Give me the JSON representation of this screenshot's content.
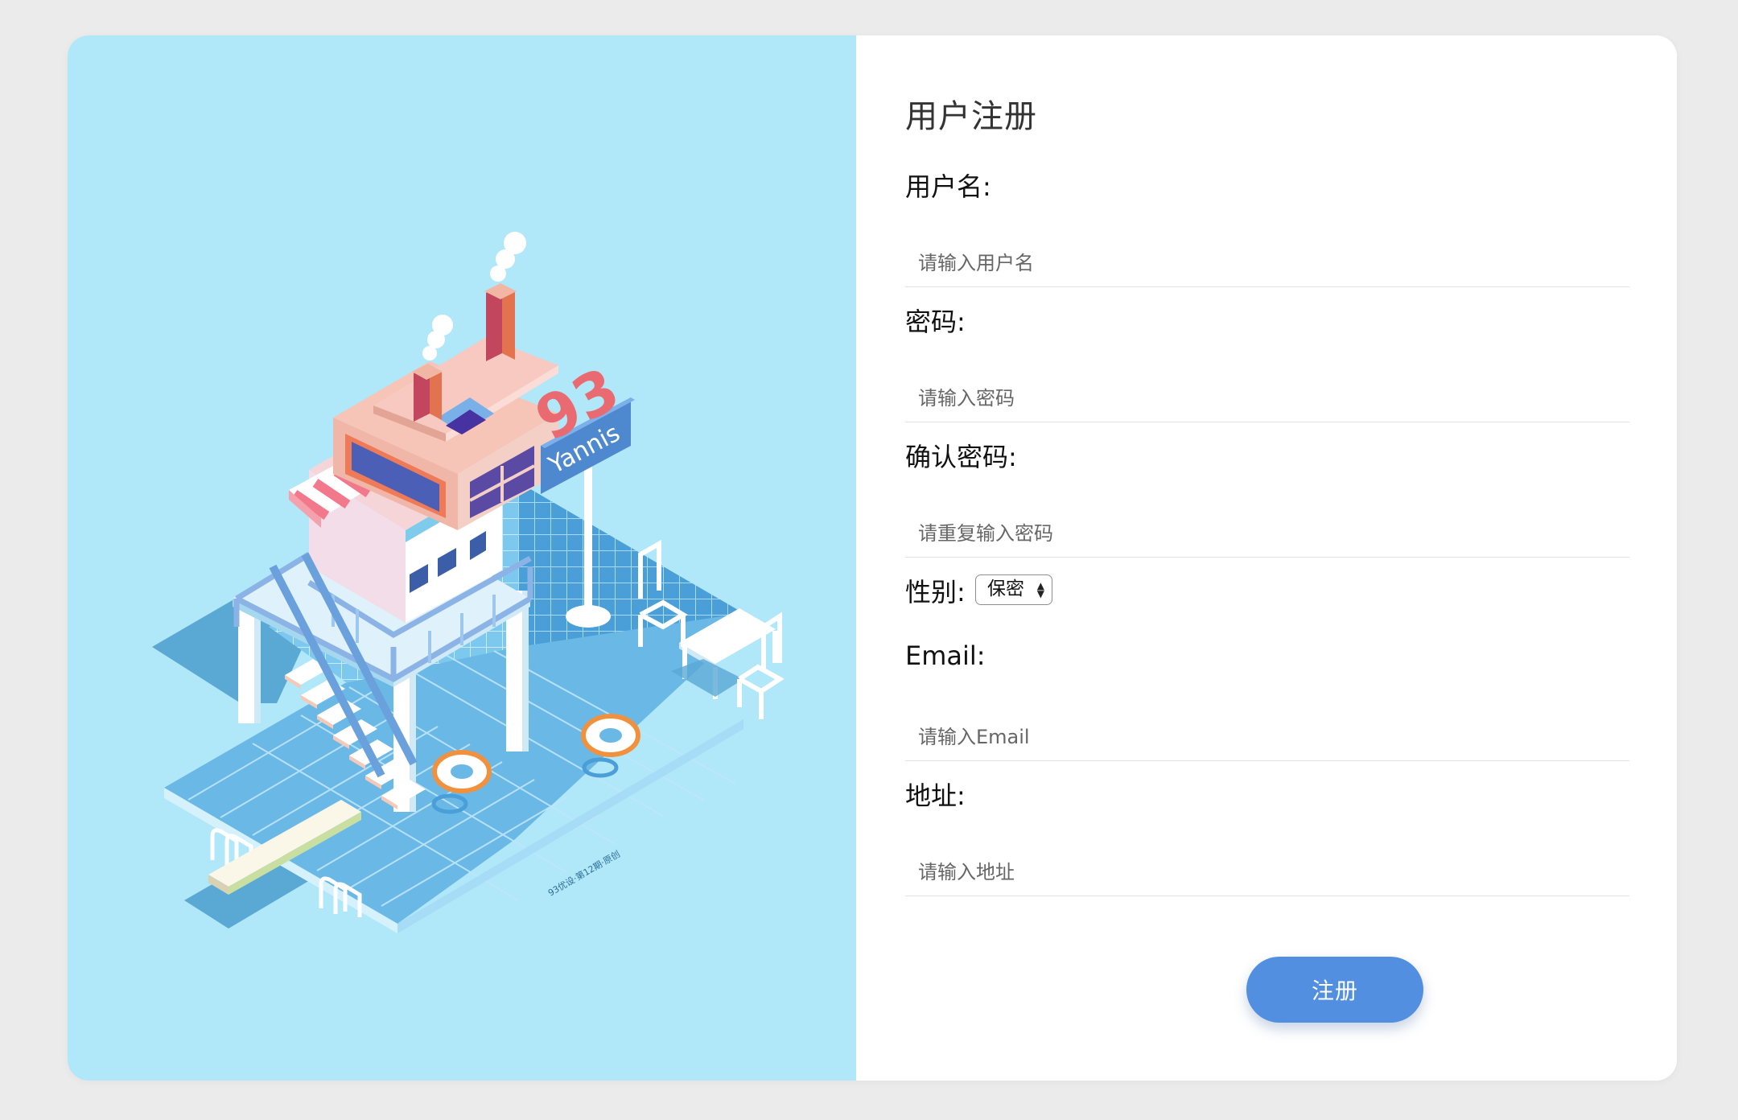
{
  "form": {
    "title": "用户注册",
    "username": {
      "label": "用户名:",
      "placeholder": "请输入用户名"
    },
    "password": {
      "label": "密码:",
      "placeholder": "请输入密码"
    },
    "confirm_password": {
      "label": "确认密码:",
      "placeholder": "请重复输入密码"
    },
    "gender": {
      "label": "性别:",
      "selected": "保密"
    },
    "email": {
      "label": "Email:",
      "placeholder": "请输入Email"
    },
    "address": {
      "label": "地址:",
      "placeholder": "请输入地址"
    },
    "submit_label": "注册"
  },
  "illustration": {
    "sign_number": "93",
    "sign_name": "Yannis",
    "caption": "93优设·第12期·原创"
  },
  "colors": {
    "page_bg": "#ebebeb",
    "panel_bg": "#b0e7f9",
    "button": "#528fe0",
    "pool_tile": "#6ab8e6"
  }
}
